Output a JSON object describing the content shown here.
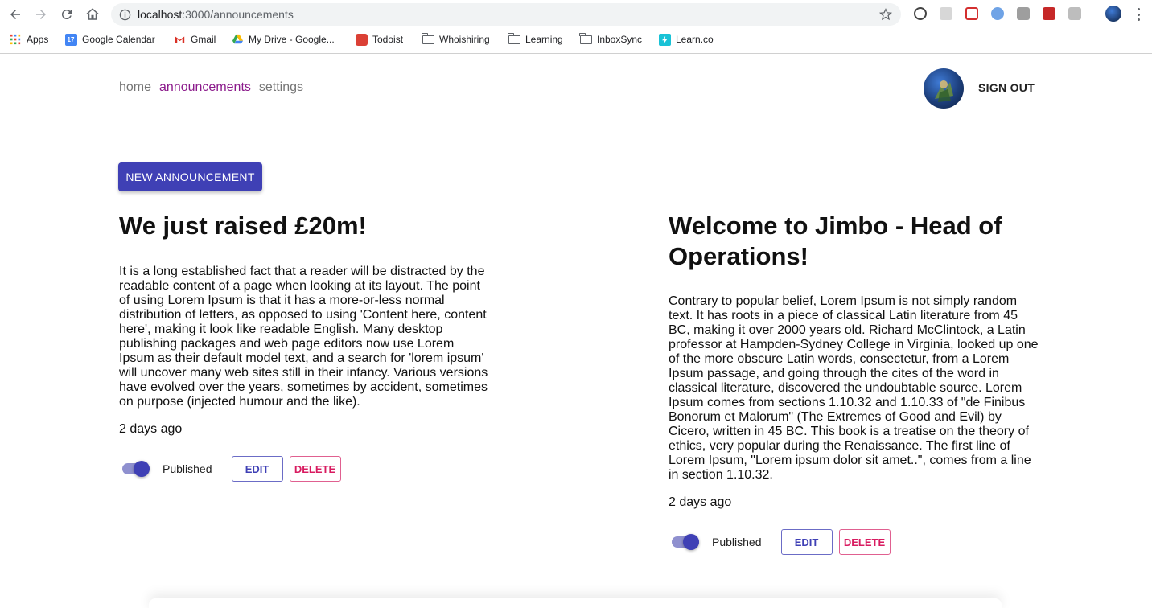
{
  "browser": {
    "url_host": "localhost",
    "url_path": ":3000/announcements",
    "bookmarks": [
      {
        "label": "Apps",
        "icon": "apps-grid-icon"
      },
      {
        "label": "Google Calendar",
        "icon": "calendar-icon"
      },
      {
        "label": "Gmail",
        "icon": "gmail-icon"
      },
      {
        "label": "My Drive - Google...",
        "icon": "drive-icon"
      },
      {
        "label": "Todoist",
        "icon": "todoist-icon"
      },
      {
        "label": "Whoishiring",
        "icon": "folder-icon"
      },
      {
        "label": "Learning",
        "icon": "folder-icon"
      },
      {
        "label": "InboxSync",
        "icon": "folder-icon"
      },
      {
        "label": "Learn.co",
        "icon": "learnco-icon"
      }
    ],
    "calendar_day": "17"
  },
  "nav": {
    "items": [
      {
        "label": "home",
        "active": false
      },
      {
        "label": "announcements",
        "active": true
      },
      {
        "label": "settings",
        "active": false
      }
    ],
    "sign_out": "SIGN OUT"
  },
  "new_announcement_label": "NEW ANNOUNCEMENT",
  "announcements": [
    {
      "title": "We just raised £20m!",
      "body": "It is a long established fact that a reader will be distracted by the readable content of a page when looking at its layout. The point of using Lorem Ipsum is that it has a more-or-less normal distribution of letters, as opposed to using 'Content here, content here', making it look like readable English. Many desktop publishing packages and web page editors now use Lorem Ipsum as their default model text, and a search for 'lorem ipsum' will uncover many web sites still in their infancy. Various versions have evolved over the years, sometimes by accident, sometimes on purpose (injected humour and the like).",
      "date": "2 days ago",
      "published": true,
      "published_label": "Published",
      "edit_label": "EDIT",
      "delete_label": "DELETE"
    },
    {
      "title": "Welcome to Jimbo - Head of Operations!",
      "body": "Contrary to popular belief, Lorem Ipsum is not simply random text. It has roots in a piece of classical Latin literature from 45 BC, making it over 2000 years old. Richard McClintock, a Latin professor at Hampden-Sydney College in Virginia, looked up one of the more obscure Latin words, consectetur, from a Lorem Ipsum passage, and going through the cites of the word in classical literature, discovered the undoubtable source. Lorem Ipsum comes from sections 1.10.32 and 1.10.33 of \"de Finibus Bonorum et Malorum\" (The Extremes of Good and Evil) by Cicero, written in 45 BC. This book is a treatise on the theory of ethics, very popular during the Renaissance. The first line of Lorem Ipsum, \"Lorem ipsum dolor sit amet..\", comes from a line in section 1.10.32.",
      "date": "2 days ago",
      "published": true,
      "published_label": "Published",
      "edit_label": "EDIT",
      "delete_label": "DELETE"
    }
  ],
  "colors": {
    "primary": "#3f40b5",
    "active_nav": "#8b1a8b",
    "delete": "#d81b60"
  }
}
